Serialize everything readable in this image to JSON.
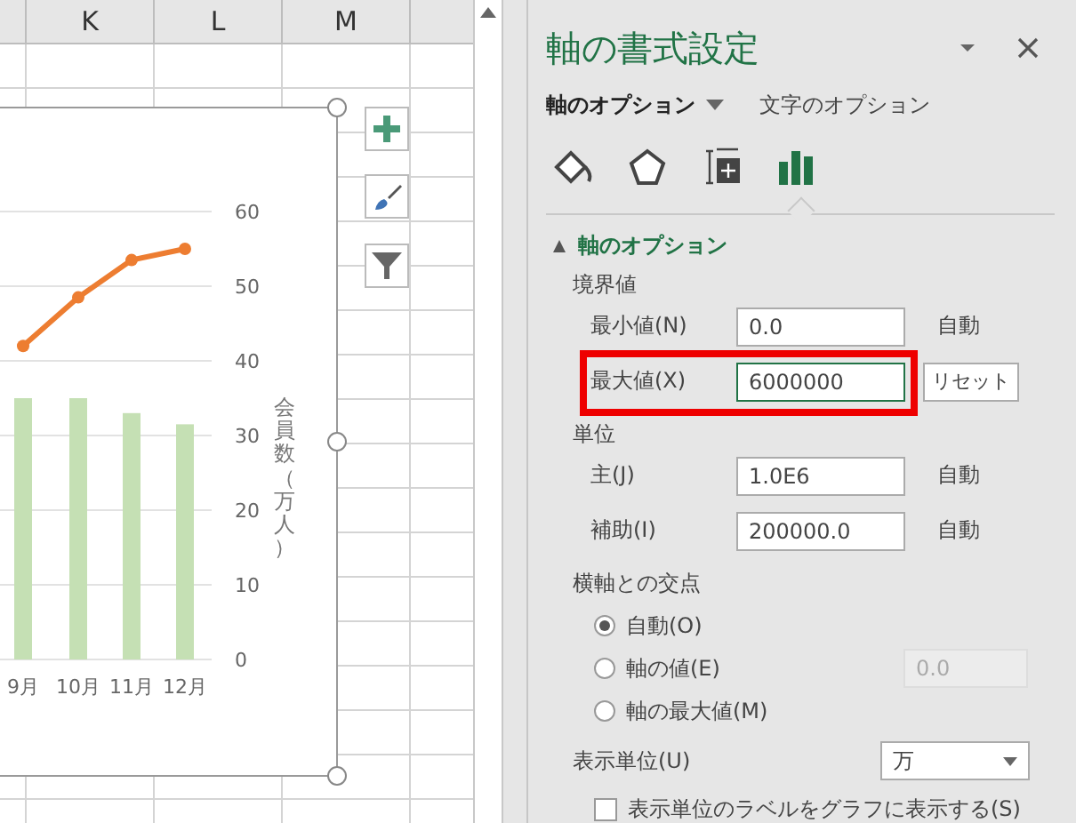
{
  "sheet": {
    "column_headers": [
      "K",
      "L",
      "M"
    ],
    "chart": {
      "chart_data": {
        "type": "bar",
        "ylabel": "会員数（万人）",
        "categories": [
          "9月",
          "10月",
          "11月",
          "12月"
        ],
        "ylim": [
          0,
          60
        ],
        "grid": true,
        "yticks": [
          0,
          10,
          20,
          30,
          40,
          50,
          60
        ],
        "series": [
          {
            "type": "bar",
            "color": "#c5e0b4",
            "values": [
              35,
              35,
              33,
              31.5
            ]
          },
          {
            "type": "line",
            "color": "#ed7d31",
            "marker": "circle",
            "values": [
              42,
              48.5,
              53.5,
              55
            ]
          }
        ]
      }
    }
  },
  "panel": {
    "title": "軸の書式設定",
    "tabs": [
      {
        "label": "軸のオプション",
        "selected": true
      },
      {
        "label": "文字のオプション",
        "selected": false
      }
    ],
    "icon_tabs": [
      {
        "kind": "fill",
        "selected": false
      },
      {
        "kind": "effects",
        "selected": false
      },
      {
        "kind": "size",
        "selected": false
      },
      {
        "kind": "axis",
        "selected": true
      }
    ],
    "section": {
      "title": "軸のオプション",
      "expanded": true
    },
    "groups": [
      {
        "title": "境界値",
        "rows": [
          {
            "label": "最小値(N)",
            "value": "0.0",
            "status": "自動",
            "highlighted": false
          },
          {
            "label": "最大値(X)",
            "value": "6000000",
            "button": "リセット",
            "highlighted": true
          }
        ]
      },
      {
        "title": "単位",
        "rows": [
          {
            "label": "主(J)",
            "value": "1.0E6",
            "status": "自動",
            "highlighted": false
          },
          {
            "label": "補助(I)",
            "value": "200000.0",
            "status": "自動",
            "highlighted": false
          }
        ]
      }
    ],
    "crossing": {
      "title": "横軸との交点",
      "options": [
        {
          "label": "自動(O)",
          "selected": true
        },
        {
          "label": "軸の値(E)",
          "selected": false,
          "value": "0.0"
        },
        {
          "label": "軸の最大値(M)",
          "selected": false
        }
      ]
    },
    "display_unit": {
      "label": "表示単位(U)",
      "value": "万"
    },
    "show_label": {
      "label": "表示単位のラベルをグラフに表示する(S)",
      "checked": false
    }
  }
}
